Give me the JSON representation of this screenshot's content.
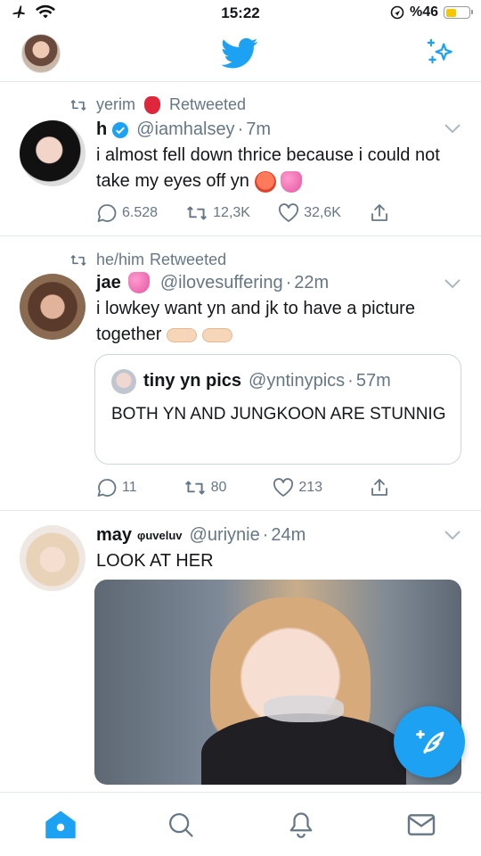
{
  "status_bar": {
    "time": "15:22",
    "battery_text": "%46",
    "battery_level": 0.46,
    "icons": [
      "airplane-icon",
      "wifi-icon",
      "location-icon",
      "battery-icon"
    ]
  },
  "nav": {
    "icons": [
      "profile-avatar",
      "twitter-bird-icon",
      "sparkle-icon"
    ],
    "accent": "#1da1f2"
  },
  "tweets": [
    {
      "retweet_by": "yerim",
      "retweet_label": "Retweeted",
      "name": "h",
      "verified": true,
      "handle": "@iamhalsey",
      "time": "7m",
      "text": "i almost fell down thrice because i could not take my eyes off yn",
      "emojis": [
        "hot-face-emoji",
        "sparkling-heart-emoji"
      ],
      "replies": "6.528",
      "retweets": "12,3K",
      "likes": "32,6K"
    },
    {
      "retweet_by": "he/him",
      "retweet_label": "Retweeted",
      "name": "jae",
      "handle": "@ilovesuffering",
      "time": "22m",
      "text": "i lowkey want yn and jk to have a picture together",
      "emojis": [
        "sparkling-heart-emoji",
        "pointing-right-emoji",
        "pointing-left-emoji"
      ],
      "quote": {
        "name": "tiny yn pics",
        "handle": "@yntinypics",
        "time": "57m",
        "text": "BOTH YN AND JUNGKOON ARE STUNNIG"
      },
      "replies": "11",
      "retweets": "80",
      "likes": "213"
    },
    {
      "name": "may",
      "name_tag": "φuveluv",
      "handle": "@uriynie",
      "time": "24m",
      "text": "LOOK AT HER",
      "has_media": true
    }
  ],
  "tab_bar": {
    "icons": [
      "home-icon",
      "search-icon",
      "notifications-icon",
      "messages-icon"
    ],
    "active": "home"
  },
  "fab": {
    "icon": "compose-tweet-icon"
  }
}
